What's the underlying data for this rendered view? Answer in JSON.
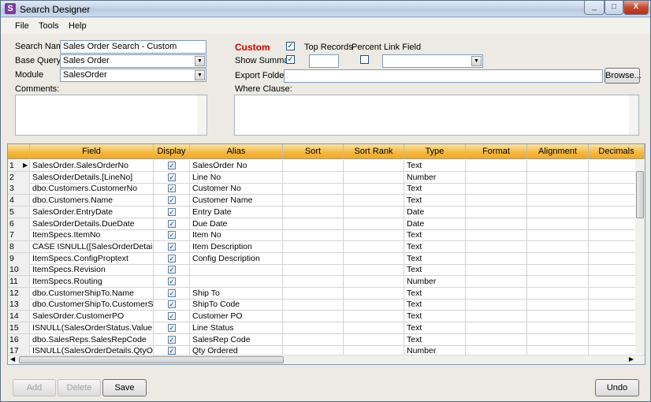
{
  "window": {
    "title": "Search Designer",
    "icon": "app-icon",
    "controls": [
      "_",
      "□",
      "X"
    ]
  },
  "menu": [
    "File",
    "Tools",
    "Help"
  ],
  "form": {
    "search_name_label": "Search Name",
    "search_name_value": "Sales Order Search - Custom",
    "base_query_label": "Base Query",
    "base_query_value": "Sales Order",
    "module_label": "Module",
    "module_value": "SalesOrder",
    "comments_label": "Comments:",
    "custom_label": "Custom",
    "custom_checked": true,
    "top_records_label": "Top Records",
    "percent_label": "Percent",
    "percent_checked": false,
    "link_field_label": "Link Field",
    "show_summary_label": "Show Summar",
    "show_summary_checked": true,
    "top_records_value": "",
    "link_field_value": "",
    "export_folder_label": "Export Folder",
    "export_folder_value": "",
    "browse_label": "Browse...",
    "where_clause_label": "Where Clause:"
  },
  "grid": {
    "columns": [
      "",
      "Field",
      "Display",
      "Alias",
      "Sort",
      "Sort Rank",
      "Type",
      "Format",
      "Alignment",
      "Decimals"
    ],
    "rows": [
      {
        "n": "1",
        "field": "SalesOrder.SalesOrderNo",
        "display": true,
        "alias": "SalesOrder No",
        "type": "Text"
      },
      {
        "n": "2",
        "field": "SalesOrderDetails.[LineNo]",
        "display": true,
        "alias": "Line No",
        "type": "Number"
      },
      {
        "n": "3",
        "field": "dbo.Customers.CustomerNo",
        "display": true,
        "alias": "Customer No",
        "type": "Text"
      },
      {
        "n": "4",
        "field": "dbo.Customers.Name",
        "display": true,
        "alias": "Customer Name",
        "type": "Text"
      },
      {
        "n": "5",
        "field": "SalesOrder.EntryDate",
        "display": true,
        "alias": "Entry Date",
        "type": "Date"
      },
      {
        "n": "6",
        "field": "SalesOrderDetails.DueDate",
        "display": true,
        "alias": "Due Date",
        "type": "Date"
      },
      {
        "n": "7",
        "field": "ItemSpecs.ItemNo",
        "display": true,
        "alias": "Item No",
        "type": "Text"
      },
      {
        "n": "8",
        "field": "CASE  ISNULL([SalesOrderDetails].[...",
        "display": true,
        "alias": "Item Description",
        "type": "Text"
      },
      {
        "n": "9",
        "field": "ItemSpecs.ConfigProptext",
        "display": true,
        "alias": "Config Description",
        "type": "Text"
      },
      {
        "n": "10",
        "field": "ItemSpecs.Revision",
        "display": true,
        "alias": "",
        "type": "Text"
      },
      {
        "n": "11",
        "field": "ItemSpecs.Routing",
        "display": true,
        "alias": "",
        "type": "Number"
      },
      {
        "n": "12",
        "field": "dbo.CustomerShipTo.Name",
        "display": true,
        "alias": "Ship To",
        "type": "Text"
      },
      {
        "n": "13",
        "field": "dbo.CustomerShipTo.CustomerShip...",
        "display": true,
        "alias": "ShipTo Code",
        "type": "Text"
      },
      {
        "n": "14",
        "field": "SalesOrder.CustomerPO",
        "display": true,
        "alias": "Customer PO",
        "type": "Text"
      },
      {
        "n": "15",
        "field": "ISNULL(SalesOrderStatus.Value, 'E...",
        "display": true,
        "alias": "Line Status",
        "type": "Text"
      },
      {
        "n": "16",
        "field": "dbo.SalesReps.SalesRepCode",
        "display": true,
        "alias": "SalesRep Code",
        "type": "Text"
      },
      {
        "n": "17",
        "field": "ISNULL(SalesOrderDetails.QtyOrder...",
        "display": true,
        "alias": "Qty Ordered",
        "type": "Number"
      }
    ]
  },
  "buttons": {
    "add": "Add",
    "delete": "Delete",
    "save": "Save",
    "undo": "Undo"
  }
}
